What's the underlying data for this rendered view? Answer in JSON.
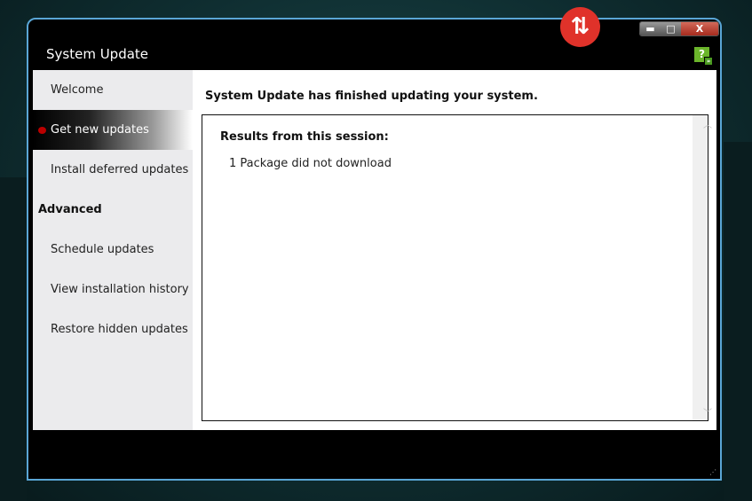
{
  "window": {
    "title": "System Update",
    "minimize": "▬",
    "maximize": "□",
    "close": "X",
    "help": "?"
  },
  "sidebar": {
    "items": [
      {
        "label": "Welcome"
      },
      {
        "label": "Get new updates",
        "selected": true
      },
      {
        "label": "Install deferred updates"
      },
      {
        "label": "Advanced",
        "heading": true
      },
      {
        "label": "Schedule updates"
      },
      {
        "label": "View installation history"
      },
      {
        "label": "Restore hidden updates"
      }
    ]
  },
  "main": {
    "status": "System Update has finished updating your system.",
    "results_title": "Results from this session:",
    "results": [
      "1 Package did not download"
    ]
  },
  "colors": {
    "accent": "#e0322a",
    "border": "#5aa6d6",
    "selected_dot": "#bb0000"
  }
}
